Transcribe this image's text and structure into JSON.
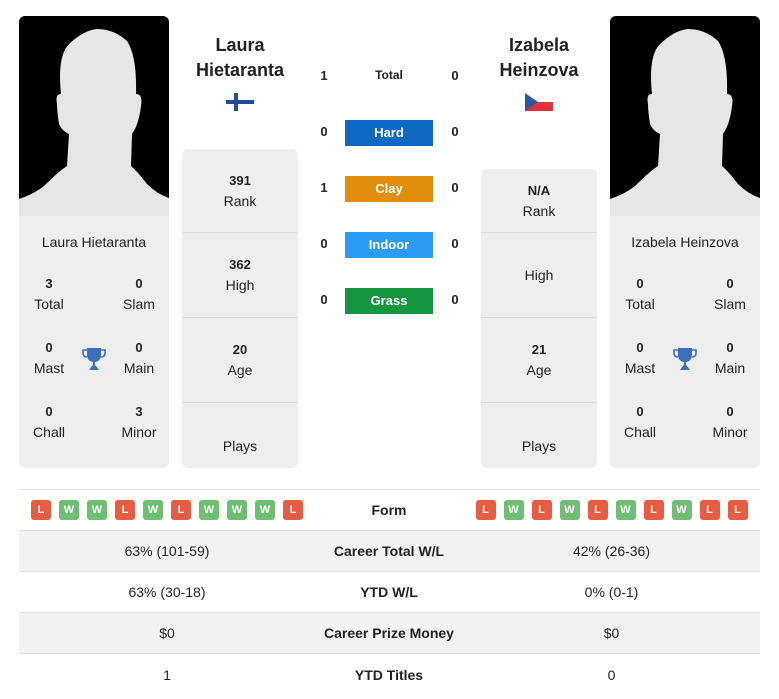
{
  "colors": {
    "hard": "#0e69c3",
    "clay": "#e08e0b",
    "indoor": "#2a9cf5",
    "grass": "#149541",
    "win": "#6fbf73",
    "loss": "#e85c41",
    "trophy": "#3b6fbf"
  },
  "player_left": {
    "name_line1": "Laura",
    "name_line2": "Hietaranta",
    "full_name": "Laura Hietaranta",
    "flag": "finland-flag",
    "titles": {
      "total": {
        "value": "3",
        "label": "Total"
      },
      "slam": {
        "value": "0",
        "label": "Slam"
      },
      "mast": {
        "value": "0",
        "label": "Mast"
      },
      "main": {
        "value": "0",
        "label": "Main"
      },
      "chall": {
        "value": "0",
        "label": "Chall"
      },
      "minor": {
        "value": "3",
        "label": "Minor"
      }
    },
    "stats": [
      {
        "value": "391",
        "label": "Rank"
      },
      {
        "value": "362",
        "label": "High"
      },
      {
        "value": "20",
        "label": "Age"
      },
      {
        "value": "",
        "label": "Plays"
      }
    ]
  },
  "player_right": {
    "name_line1": "Izabela",
    "name_line2": "Heinzova",
    "full_name": "Izabela Heinzova",
    "flag": "czech-flag",
    "titles": {
      "total": {
        "value": "0",
        "label": "Total"
      },
      "slam": {
        "value": "0",
        "label": "Slam"
      },
      "mast": {
        "value": "0",
        "label": "Mast"
      },
      "main": {
        "value": "0",
        "label": "Main"
      },
      "chall": {
        "value": "0",
        "label": "Chall"
      },
      "minor": {
        "value": "0",
        "label": "Minor"
      }
    },
    "stats": [
      {
        "value": "N/A",
        "label": "Rank"
      },
      {
        "value": "",
        "label": "High"
      },
      {
        "value": "21",
        "label": "Age"
      },
      {
        "value": "",
        "label": "Plays"
      }
    ]
  },
  "h2h": [
    {
      "label": "Total",
      "left": "1",
      "right": "0"
    },
    {
      "label": "Hard",
      "left": "0",
      "right": "0"
    },
    {
      "label": "Clay",
      "left": "1",
      "right": "0"
    },
    {
      "label": "Indoor",
      "left": "0",
      "right": "0"
    },
    {
      "label": "Grass",
      "left": "0",
      "right": "0"
    }
  ],
  "comparison": {
    "form_label": "Form",
    "form_left": [
      "L",
      "W",
      "W",
      "L",
      "W",
      "L",
      "W",
      "W",
      "W",
      "L"
    ],
    "form_right": [
      "L",
      "W",
      "L",
      "W",
      "L",
      "W",
      "L",
      "W",
      "L",
      "L"
    ],
    "rows": [
      {
        "label": "Career Total W/L",
        "left": "63% (101-59)",
        "right": "42% (26-36)"
      },
      {
        "label": "YTD W/L",
        "left": "63% (30-18)",
        "right": "0% (0-1)"
      },
      {
        "label": "Career Prize Money",
        "left": "$0",
        "right": "$0"
      },
      {
        "label": "YTD Titles",
        "left": "1",
        "right": "0"
      }
    ]
  }
}
